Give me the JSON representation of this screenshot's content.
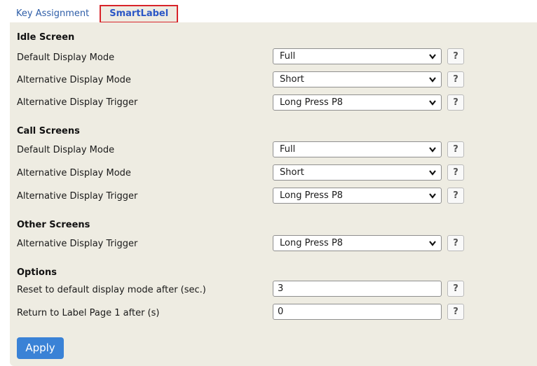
{
  "tabs": [
    {
      "label": "Key Assignment",
      "active": false
    },
    {
      "label": "SmartLabel",
      "active": true
    }
  ],
  "sections": {
    "idle": {
      "title": "Idle Screen",
      "rows": [
        {
          "label": "Default Display Mode",
          "value": "Full"
        },
        {
          "label": "Alternative Display Mode",
          "value": "Short"
        },
        {
          "label": "Alternative Display Trigger",
          "value": "Long Press P8"
        }
      ]
    },
    "call": {
      "title": "Call Screens",
      "rows": [
        {
          "label": "Default Display Mode",
          "value": "Full"
        },
        {
          "label": "Alternative Display Mode",
          "value": "Short"
        },
        {
          "label": "Alternative Display Trigger",
          "value": "Long Press P8"
        }
      ]
    },
    "other": {
      "title": "Other Screens",
      "rows": [
        {
          "label": "Alternative Display Trigger",
          "value": "Long Press P8"
        }
      ]
    },
    "options": {
      "title": "Options",
      "rows": [
        {
          "label": "Reset to default display mode after (sec.)",
          "value": "3"
        },
        {
          "label": "Return to Label Page 1 after (s)",
          "value": "0"
        }
      ]
    }
  },
  "help_label": "?",
  "apply_label": "Apply",
  "colors": {
    "panel_bg": "#eeece2",
    "accent": "#3a82d6",
    "active_tab_border": "#d8242a",
    "tab_link": "#2f5ea8"
  },
  "icons": {
    "dropdown": "chevron-down-icon",
    "help": "help-icon"
  }
}
